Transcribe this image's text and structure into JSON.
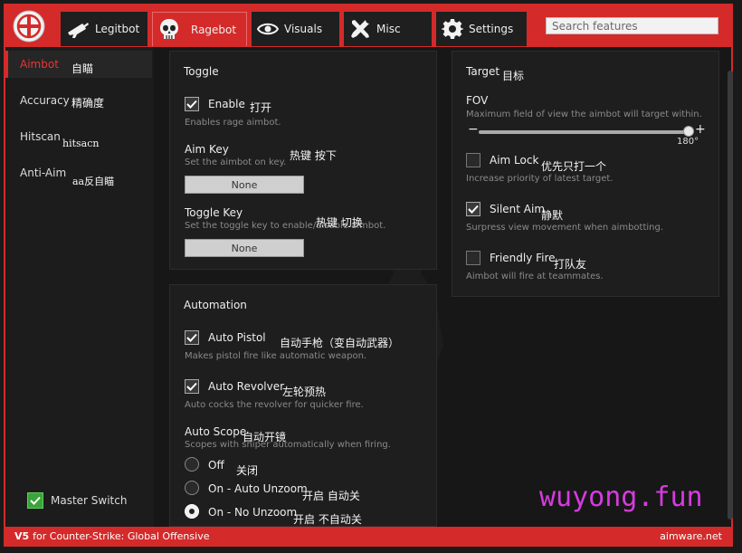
{
  "tabs": [
    {
      "label": "Legitbot",
      "icon": "rifle-icon"
    },
    {
      "label": "Ragebot",
      "icon": "skull-icon",
      "active": true
    },
    {
      "label": "Visuals",
      "icon": "eye-icon"
    },
    {
      "label": "Misc",
      "icon": "tools-icon"
    },
    {
      "label": "Settings",
      "icon": "gear-icon"
    }
  ],
  "search": {
    "placeholder": "Search features"
  },
  "sidebar": {
    "items": [
      {
        "label": "Aimbot",
        "note": "自瞄",
        "active": true
      },
      {
        "label": "Accuracy",
        "note": "精确度"
      },
      {
        "label": "Hitscan",
        "note": "hitsacn"
      },
      {
        "label": "Anti-Aim",
        "note": "aa反自瞄"
      }
    ],
    "master_switch": {
      "label": "Master Switch",
      "checked": true
    }
  },
  "toggle_group": {
    "title": "Toggle",
    "enable": {
      "label": "Enable",
      "note": "打开",
      "desc": "Enables rage aimbot.",
      "checked": true
    },
    "aim_key": {
      "label": "Aim Key",
      "note": "热键 按下",
      "desc": "Set the aimbot on key.",
      "value": "None"
    },
    "toggle_key": {
      "label": "Toggle Key",
      "note": "热键 切换",
      "desc": "Set the toggle key to enable/disable aimbot.",
      "value": "None"
    }
  },
  "automation_group": {
    "title": "Automation",
    "auto_pistol": {
      "label": "Auto Pistol",
      "note": "自动手枪（变自动武器）",
      "desc": "Makes pistol fire like automatic weapon.",
      "checked": true
    },
    "auto_revolver": {
      "label": "Auto Revolver",
      "note": "左轮预热",
      "desc": "Auto cocks the revolver for quicker fire.",
      "checked": true
    },
    "auto_scope": {
      "label": "Auto Scope",
      "note": "自动开镜",
      "desc": "Scopes with sniper automatically when firing."
    },
    "scope_options": [
      {
        "label": "Off",
        "note": "关闭",
        "selected": false
      },
      {
        "label": "On - Auto Unzoom",
        "note": "开启 自动关",
        "selected": false
      },
      {
        "label": "On - No Unzoom",
        "note": "开启 不自动关",
        "selected": true
      }
    ]
  },
  "target_group": {
    "title": "Target",
    "title_note": "目标",
    "fov": {
      "label": "FOV",
      "desc": "Maximum field of view the aimbot will target within.",
      "value": 180,
      "max": 180,
      "value_text": "180°",
      "minus": "−",
      "plus": "+"
    },
    "aim_lock": {
      "label": "Aim Lock",
      "note": "优先只打一个",
      "desc": "Increase priority of latest target.",
      "checked": false
    },
    "silent_aim": {
      "label": "Silent Aim",
      "note": "静默",
      "desc": "Surpress view movement when aimbotting.",
      "checked": true
    },
    "friendly_fire": {
      "label": "Friendly Fire",
      "note": "打队友",
      "desc": "Aimbot will fire at teammates.",
      "checked": false
    }
  },
  "footer": {
    "version": "V5",
    "text": "for Counter-Strike: Global Offensive",
    "brand": "aimware.net"
  },
  "watermark": "wuyong.fun",
  "colors": {
    "accent": "#d42a2a",
    "master_green": "#3aa33a",
    "watermark": "#d63be0"
  }
}
